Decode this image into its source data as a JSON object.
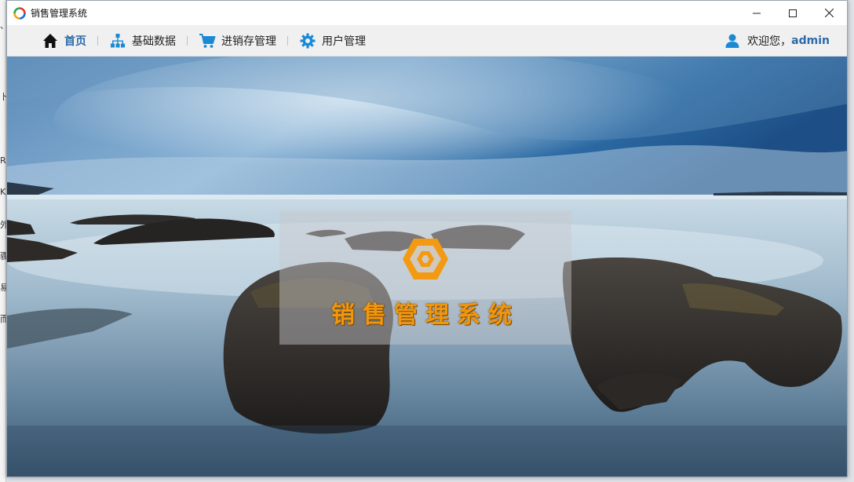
{
  "window": {
    "title": "销售管理系统",
    "controls": {
      "minimize": "—",
      "maximize": "☐",
      "close": "✕"
    }
  },
  "nav": {
    "items": [
      {
        "label": "首页",
        "icon": "home-icon",
        "active": true
      },
      {
        "label": "基础数据",
        "icon": "sitemap-icon",
        "active": false
      },
      {
        "label": "进销存管理",
        "icon": "cart-icon",
        "active": false
      },
      {
        "label": "用户管理",
        "icon": "gear-icon",
        "active": false
      }
    ],
    "user": {
      "greeting": "欢迎您，",
      "name": "admin",
      "icon": "user-icon"
    }
  },
  "brand": {
    "title": "销售管理系统",
    "logo": "hexagon-logo-icon",
    "color": "#f0960f"
  },
  "colors": {
    "accent": "#2d6aa8",
    "nav_icon": "#1a8ad4"
  },
  "behind_window_glyphs": [
    "、",
    "卜",
    "R",
    "K",
    "外",
    "骤",
    "易",
    "而"
  ]
}
